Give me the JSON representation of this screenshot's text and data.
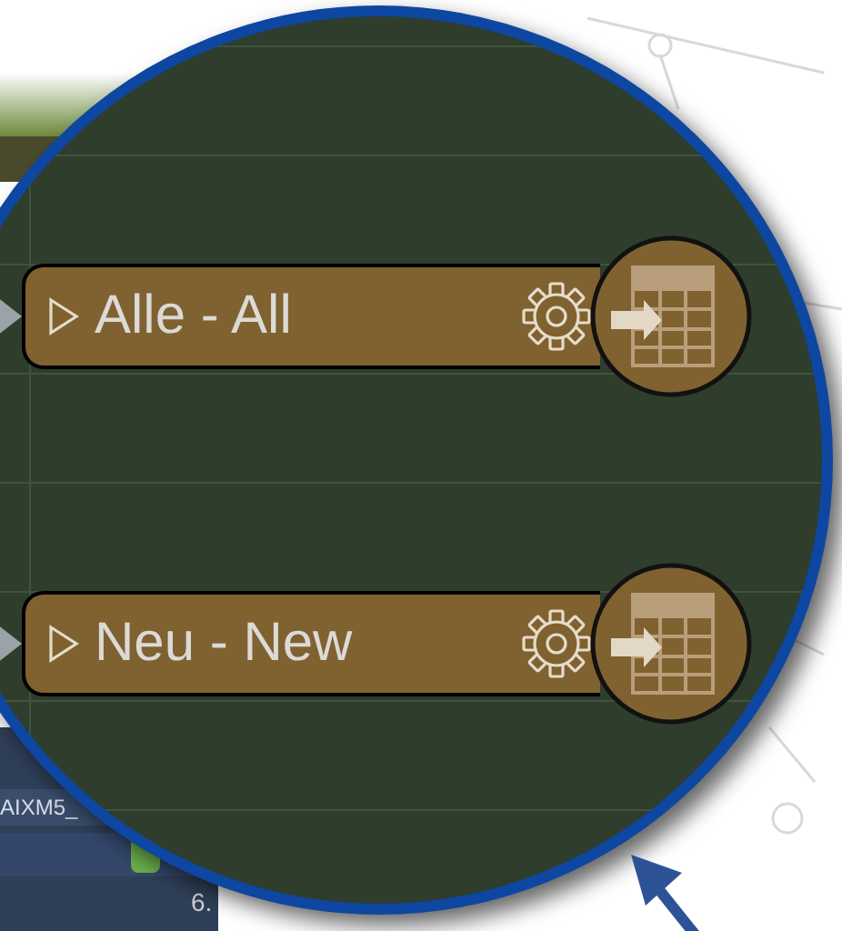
{
  "nodes": [
    {
      "label": "Alle - All"
    },
    {
      "label": "Neu - New"
    }
  ],
  "side_panel": {
    "field_text": "AIXM5_",
    "value_text": "6."
  }
}
